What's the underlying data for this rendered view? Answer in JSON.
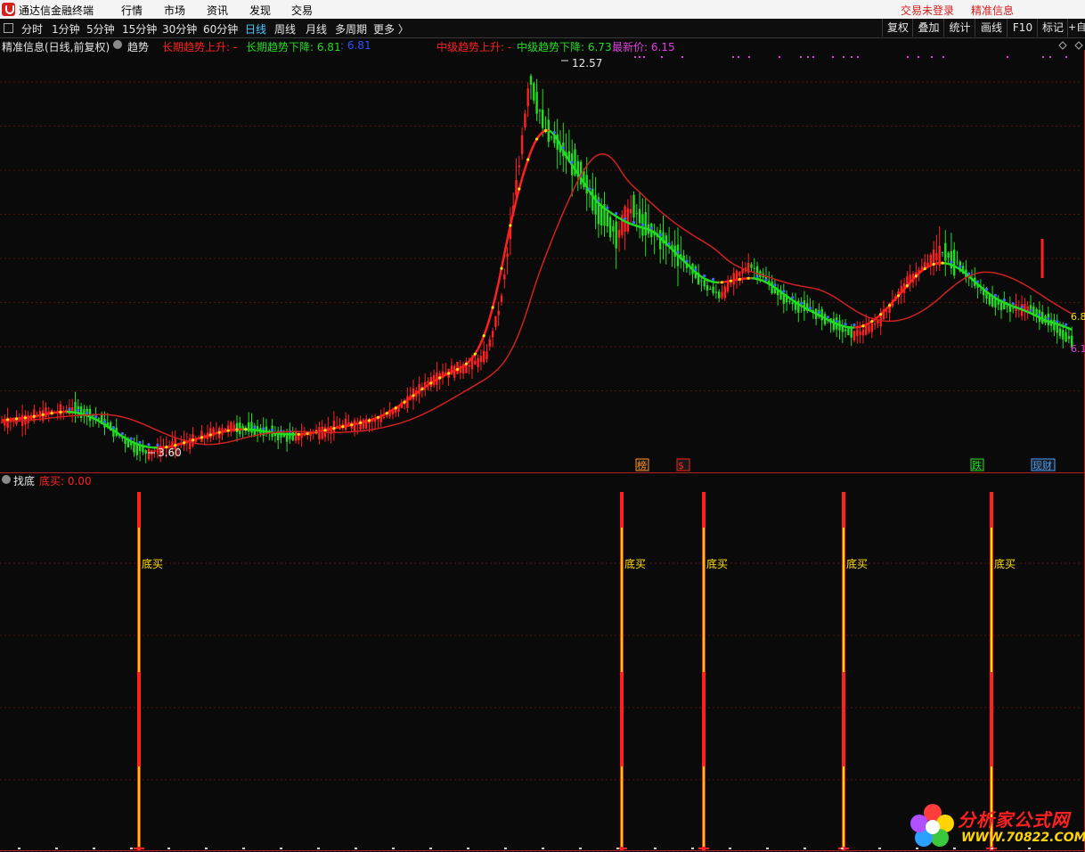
{
  "app": {
    "title": "通达信金融终端"
  },
  "menu": {
    "items": [
      "行情",
      "市场",
      "资讯",
      "发现",
      "交易"
    ],
    "login": "交易未登录",
    "info": "精准信息"
  },
  "toolbar": {
    "periods": [
      "分时",
      "1分钟",
      "5分钟",
      "15分钟",
      "30分钟",
      "60分钟",
      "日线",
      "周线",
      "月线",
      "多周期",
      "更多 〉"
    ],
    "active": "日线",
    "right": [
      "复权",
      "叠加",
      "统计",
      "画线",
      "F10",
      "标记",
      "+自"
    ]
  },
  "main_panel": {
    "title": "精准信息(日线,前复权)",
    "indicator": "趋势",
    "long_up_label": "长期趋势上升: -",
    "long_down_label": "长期趋势下降: 6.81",
    "long_down_extra": ": 6.81",
    "mid_up_label": "中级趋势上升: -",
    "mid_down_label": "中级趋势下降: 6.73",
    "latest_label": "最新价: 6.15",
    "high_label": "12.57",
    "low_label": "3.60",
    "right_value_1": "6.8",
    "right_value_2": "6.1",
    "markers": [
      "榜",
      "$",
      "跌",
      "现财"
    ]
  },
  "sub_panel": {
    "title": "找底",
    "value_label": "底买: 0.00",
    "signal_label": "底买",
    "signals": [
      {
        "index": 0
      },
      {
        "index": 1
      },
      {
        "index": 2
      },
      {
        "index": 3
      },
      {
        "index": 4
      }
    ]
  },
  "watermark": {
    "name": "分析家公式网",
    "url": "WWW.70822.COM"
  },
  "colors": {
    "up": "#ff2020",
    "down": "#22dd22",
    "accent": "#46c8ff",
    "signal_yellow": "#ffe000",
    "magenta": "#e040e0"
  },
  "chart_data": {
    "type": "candlestick",
    "price_high": 12.57,
    "price_low": 3.6,
    "latest": 6.15,
    "trend_levels": {
      "long_down": 6.81,
      "mid_down": 6.73
    },
    "close_path": [
      4.3,
      4.35,
      4.4,
      4.5,
      4.55,
      4.6,
      4.5,
      4.3,
      4.0,
      3.75,
      3.6,
      3.7,
      3.8,
      3.85,
      4.0,
      4.1,
      4.2,
      4.15,
      4.1,
      4.0,
      3.95,
      4.05,
      4.1,
      4.2,
      4.25,
      4.3,
      4.4,
      4.6,
      4.9,
      5.2,
      5.4,
      5.5,
      5.6,
      5.8,
      7.0,
      9.5,
      12.2,
      11.0,
      10.6,
      10.2,
      9.6,
      9.0,
      8.6,
      9.2,
      8.7,
      8.5,
      8.2,
      7.8,
      7.4,
      7.2,
      7.6,
      7.9,
      7.6,
      7.2,
      7.0,
      6.9,
      6.7,
      6.5,
      6.3,
      6.4,
      6.7,
      7.2,
      7.6,
      7.9,
      8.2,
      8.0,
      7.6,
      7.2,
      7.0,
      6.9,
      6.9,
      6.7,
      6.4,
      6.15
    ]
  }
}
